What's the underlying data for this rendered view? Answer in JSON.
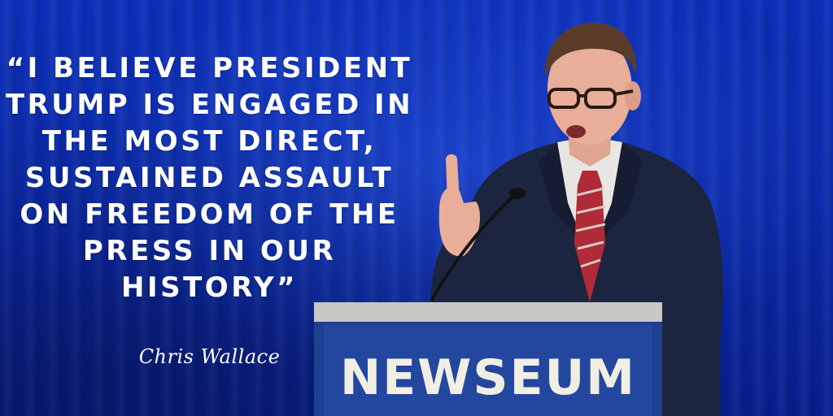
{
  "quote": {
    "lines": [
      "“I BELIEVE PRESIDENT",
      "TRUMP IS ENGAGED IN",
      "THE MOST DIRECT,",
      "SUSTAINED ASSAULT",
      "ON FREEDOM OF THE",
      "PRESS IN OUR",
      "HISTORY”"
    ]
  },
  "attribution": "Chris Wallace",
  "podium": {
    "sign": "NEWSEUM"
  },
  "colors": {
    "background": "#0b2aa8",
    "text": "#ffffff",
    "podium": "#1f3f8f",
    "podium_sign_text": "#f1eee3"
  }
}
